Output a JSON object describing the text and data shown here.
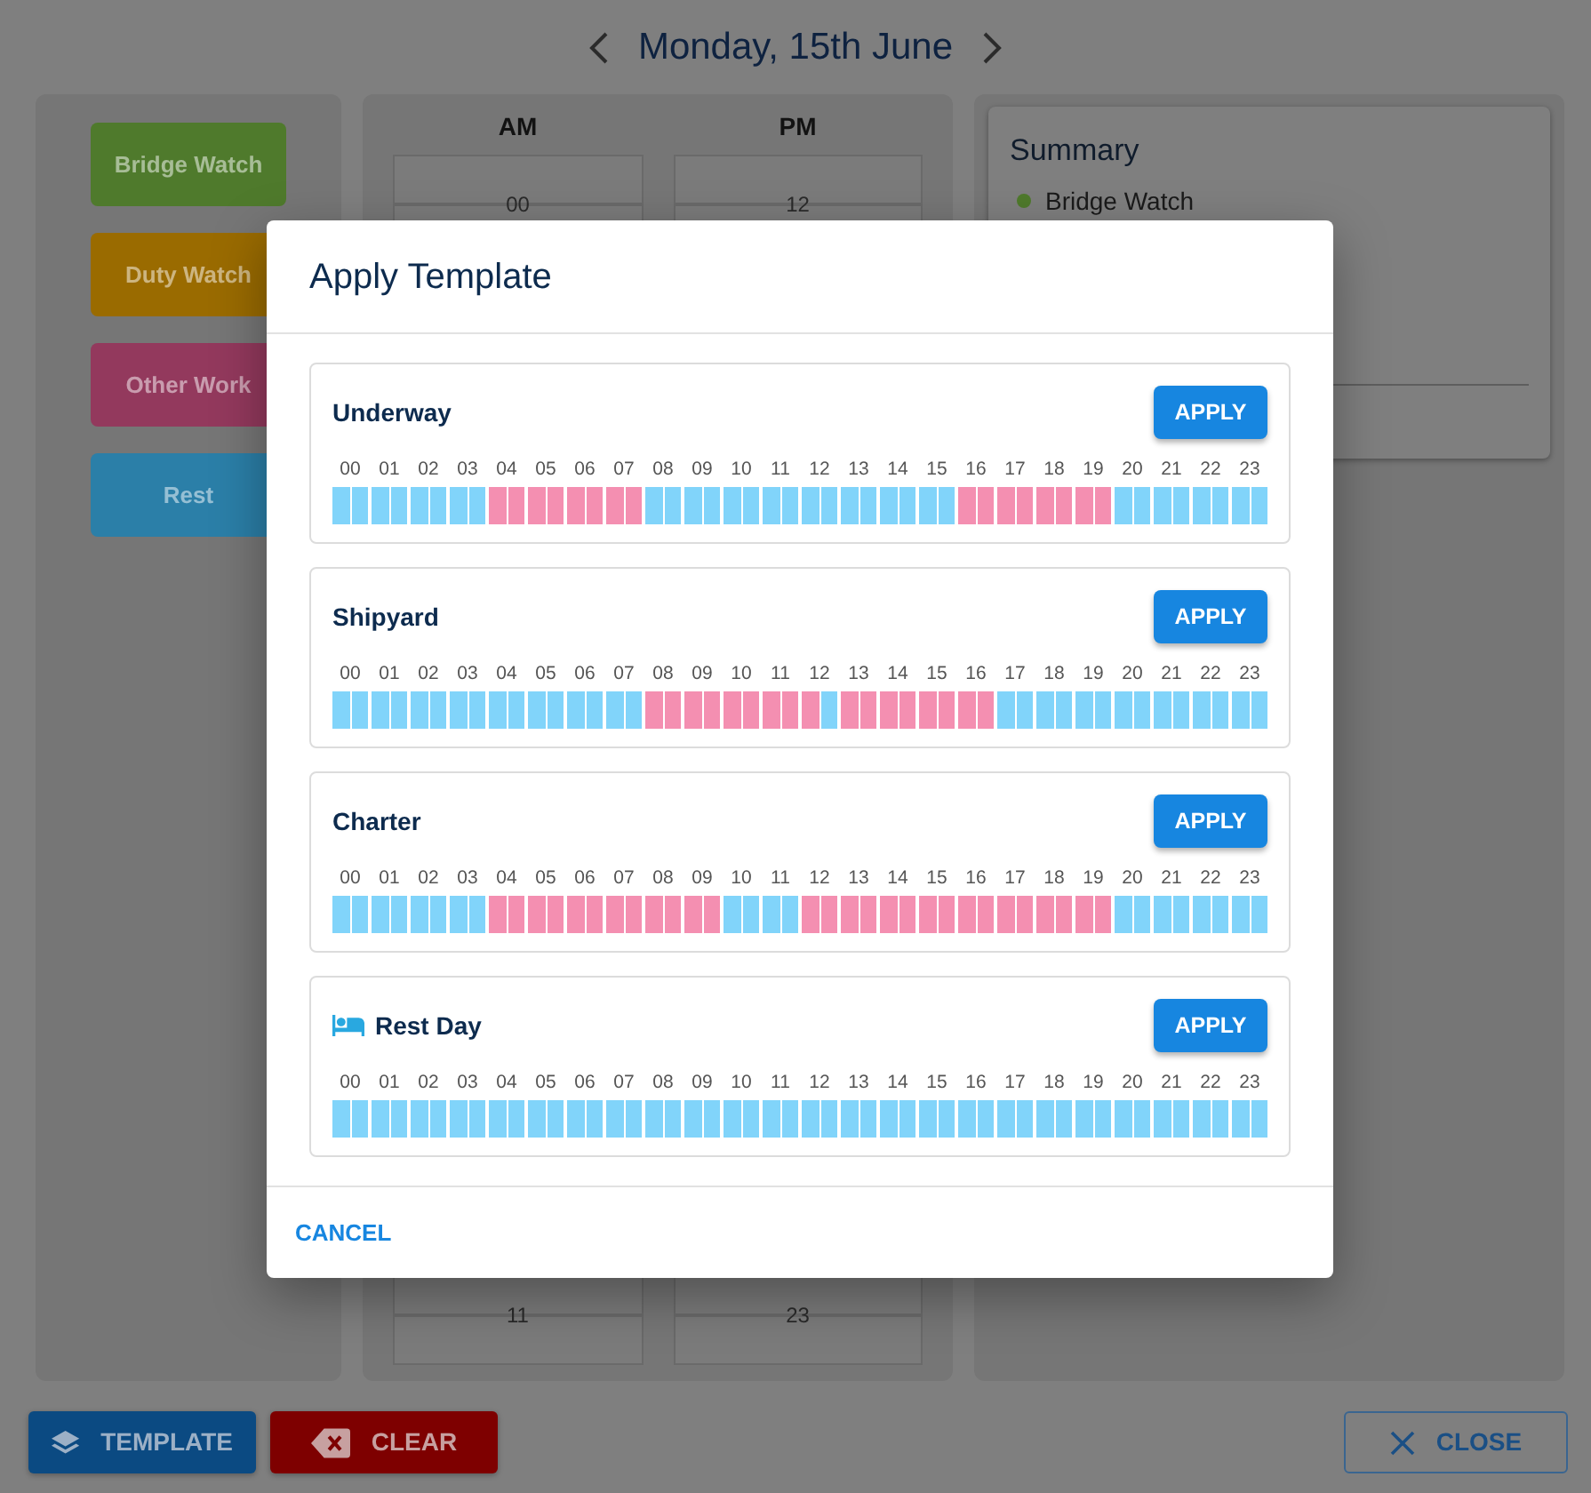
{
  "header": {
    "title": "Monday, 15th June"
  },
  "activities": [
    {
      "label": "Bridge Watch",
      "color": "#4f7a2c"
    },
    {
      "label": "Duty Watch",
      "color": "#9a6b00"
    },
    {
      "label": "Other Work",
      "color": "#93395d"
    },
    {
      "label": "Rest",
      "color": "#2b7fa8"
    }
  ],
  "hour_grid": {
    "columns": [
      {
        "heading": "AM",
        "first_hour": "00",
        "last_hour": "11"
      },
      {
        "heading": "PM",
        "first_hour": "12",
        "last_hour": "23"
      }
    ]
  },
  "summary": {
    "title": "Summary",
    "items": [
      {
        "label": "Bridge Watch",
        "color": "#4f7a2c"
      }
    ]
  },
  "modal": {
    "title": "Apply Template",
    "templates": [
      {
        "name": "Underway",
        "kind": "standard",
        "button": "APPLY",
        "hours": [
          {
            "label": "00",
            "first_half_work": false,
            "second_half_work": false
          },
          {
            "label": "01",
            "first_half_work": false,
            "second_half_work": false
          },
          {
            "label": "02",
            "first_half_work": false,
            "second_half_work": false
          },
          {
            "label": "03",
            "first_half_work": false,
            "second_half_work": false
          },
          {
            "label": "04",
            "first_half_work": true,
            "second_half_work": true
          },
          {
            "label": "05",
            "first_half_work": true,
            "second_half_work": true
          },
          {
            "label": "06",
            "first_half_work": true,
            "second_half_work": true
          },
          {
            "label": "07",
            "first_half_work": true,
            "second_half_work": true
          },
          {
            "label": "08",
            "first_half_work": false,
            "second_half_work": false
          },
          {
            "label": "09",
            "first_half_work": false,
            "second_half_work": false
          },
          {
            "label": "10",
            "first_half_work": false,
            "second_half_work": false
          },
          {
            "label": "11",
            "first_half_work": false,
            "second_half_work": false
          },
          {
            "label": "12",
            "first_half_work": false,
            "second_half_work": false
          },
          {
            "label": "13",
            "first_half_work": false,
            "second_half_work": false
          },
          {
            "label": "14",
            "first_half_work": false,
            "second_half_work": false
          },
          {
            "label": "15",
            "first_half_work": false,
            "second_half_work": false
          },
          {
            "label": "16",
            "first_half_work": true,
            "second_half_work": true
          },
          {
            "label": "17",
            "first_half_work": true,
            "second_half_work": true
          },
          {
            "label": "18",
            "first_half_work": true,
            "second_half_work": true
          },
          {
            "label": "19",
            "first_half_work": true,
            "second_half_work": true
          },
          {
            "label": "20",
            "first_half_work": false,
            "second_half_work": false
          },
          {
            "label": "21",
            "first_half_work": false,
            "second_half_work": false
          },
          {
            "label": "22",
            "first_half_work": false,
            "second_half_work": false
          },
          {
            "label": "23",
            "first_half_work": false,
            "second_half_work": false
          }
        ]
      },
      {
        "name": "Shipyard",
        "kind": "standard",
        "button": "APPLY",
        "hours": [
          {
            "label": "00",
            "first_half_work": false,
            "second_half_work": false
          },
          {
            "label": "01",
            "first_half_work": false,
            "second_half_work": false
          },
          {
            "label": "02",
            "first_half_work": false,
            "second_half_work": false
          },
          {
            "label": "03",
            "first_half_work": false,
            "second_half_work": false
          },
          {
            "label": "04",
            "first_half_work": false,
            "second_half_work": false
          },
          {
            "label": "05",
            "first_half_work": false,
            "second_half_work": false
          },
          {
            "label": "06",
            "first_half_work": false,
            "second_half_work": false
          },
          {
            "label": "07",
            "first_half_work": false,
            "second_half_work": false
          },
          {
            "label": "08",
            "first_half_work": true,
            "second_half_work": true
          },
          {
            "label": "09",
            "first_half_work": true,
            "second_half_work": true
          },
          {
            "label": "10",
            "first_half_work": true,
            "second_half_work": true
          },
          {
            "label": "11",
            "first_half_work": true,
            "second_half_work": true
          },
          {
            "label": "12",
            "first_half_work": true,
            "second_half_work": false
          },
          {
            "label": "13",
            "first_half_work": true,
            "second_half_work": true
          },
          {
            "label": "14",
            "first_half_work": true,
            "second_half_work": true
          },
          {
            "label": "15",
            "first_half_work": true,
            "second_half_work": true
          },
          {
            "label": "16",
            "first_half_work": true,
            "second_half_work": true
          },
          {
            "label": "17",
            "first_half_work": false,
            "second_half_work": false
          },
          {
            "label": "18",
            "first_half_work": false,
            "second_half_work": false
          },
          {
            "label": "19",
            "first_half_work": false,
            "second_half_work": false
          },
          {
            "label": "20",
            "first_half_work": false,
            "second_half_work": false
          },
          {
            "label": "21",
            "first_half_work": false,
            "second_half_work": false
          },
          {
            "label": "22",
            "first_half_work": false,
            "second_half_work": false
          },
          {
            "label": "23",
            "first_half_work": false,
            "second_half_work": false
          }
        ]
      },
      {
        "name": "Charter",
        "kind": "standard",
        "button": "APPLY",
        "hours": [
          {
            "label": "00",
            "first_half_work": false,
            "second_half_work": false
          },
          {
            "label": "01",
            "first_half_work": false,
            "second_half_work": false
          },
          {
            "label": "02",
            "first_half_work": false,
            "second_half_work": false
          },
          {
            "label": "03",
            "first_half_work": false,
            "second_half_work": false
          },
          {
            "label": "04",
            "first_half_work": true,
            "second_half_work": true
          },
          {
            "label": "05",
            "first_half_work": true,
            "second_half_work": true
          },
          {
            "label": "06",
            "first_half_work": true,
            "second_half_work": true
          },
          {
            "label": "07",
            "first_half_work": true,
            "second_half_work": true
          },
          {
            "label": "08",
            "first_half_work": true,
            "second_half_work": true
          },
          {
            "label": "09",
            "first_half_work": true,
            "second_half_work": true
          },
          {
            "label": "10",
            "first_half_work": false,
            "second_half_work": false
          },
          {
            "label": "11",
            "first_half_work": false,
            "second_half_work": false
          },
          {
            "label": "12",
            "first_half_work": true,
            "second_half_work": true
          },
          {
            "label": "13",
            "first_half_work": true,
            "second_half_work": true
          },
          {
            "label": "14",
            "first_half_work": true,
            "second_half_work": true
          },
          {
            "label": "15",
            "first_half_work": true,
            "second_half_work": true
          },
          {
            "label": "16",
            "first_half_work": true,
            "second_half_work": true
          },
          {
            "label": "17",
            "first_half_work": true,
            "second_half_work": true
          },
          {
            "label": "18",
            "first_half_work": true,
            "second_half_work": true
          },
          {
            "label": "19",
            "first_half_work": true,
            "second_half_work": true
          },
          {
            "label": "20",
            "first_half_work": false,
            "second_half_work": false
          },
          {
            "label": "21",
            "first_half_work": false,
            "second_half_work": false
          },
          {
            "label": "22",
            "first_half_work": false,
            "second_half_work": false
          },
          {
            "label": "23",
            "first_half_work": false,
            "second_half_work": false
          }
        ]
      },
      {
        "name": "Rest Day",
        "kind": "restday",
        "button": "APPLY",
        "hours": [
          {
            "label": "00",
            "first_half_work": false,
            "second_half_work": false
          },
          {
            "label": "01",
            "first_half_work": false,
            "second_half_work": false
          },
          {
            "label": "02",
            "first_half_work": false,
            "second_half_work": false
          },
          {
            "label": "03",
            "first_half_work": false,
            "second_half_work": false
          },
          {
            "label": "04",
            "first_half_work": false,
            "second_half_work": false
          },
          {
            "label": "05",
            "first_half_work": false,
            "second_half_work": false
          },
          {
            "label": "06",
            "first_half_work": false,
            "second_half_work": false
          },
          {
            "label": "07",
            "first_half_work": false,
            "second_half_work": false
          },
          {
            "label": "08",
            "first_half_work": false,
            "second_half_work": false
          },
          {
            "label": "09",
            "first_half_work": false,
            "second_half_work": false
          },
          {
            "label": "10",
            "first_half_work": false,
            "second_half_work": false
          },
          {
            "label": "11",
            "first_half_work": false,
            "second_half_work": false
          },
          {
            "label": "12",
            "first_half_work": false,
            "second_half_work": false
          },
          {
            "label": "13",
            "first_half_work": false,
            "second_half_work": false
          },
          {
            "label": "14",
            "first_half_work": false,
            "second_half_work": false
          },
          {
            "label": "15",
            "first_half_work": false,
            "second_half_work": false
          },
          {
            "label": "16",
            "first_half_work": false,
            "second_half_work": false
          },
          {
            "label": "17",
            "first_half_work": false,
            "second_half_work": false
          },
          {
            "label": "18",
            "first_half_work": false,
            "second_half_work": false
          },
          {
            "label": "19",
            "first_half_work": false,
            "second_half_work": false
          },
          {
            "label": "20",
            "first_half_work": false,
            "second_half_work": false
          },
          {
            "label": "21",
            "first_half_work": false,
            "second_half_work": false
          },
          {
            "label": "22",
            "first_half_work": false,
            "second_half_work": false
          },
          {
            "label": "23",
            "first_half_work": false,
            "second_half_work": false
          }
        ]
      }
    ],
    "cancel": "CANCEL"
  },
  "footer": {
    "buttons": [
      {
        "label": "TEMPLATE",
        "kind": "template"
      },
      {
        "label": "CLEAR",
        "kind": "clear"
      },
      {
        "label": "CLOSE",
        "kind": "close"
      }
    ]
  }
}
